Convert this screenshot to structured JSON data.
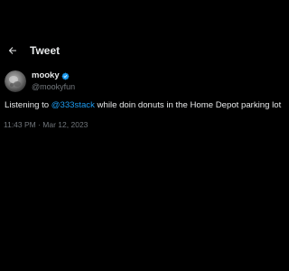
{
  "header": {
    "title": "Tweet",
    "back_icon": "back-arrow-icon"
  },
  "author": {
    "display_name": "mooky",
    "handle": "@mookyfun",
    "verified_icon": "verified-badge-icon",
    "verified_color": "#1d9bf0"
  },
  "tweet": {
    "text_before": "Listening to ",
    "mention": "@333stack",
    "text_after": " while doin donuts in the Home Depot parking lot",
    "timestamp": "11:43 PM · Mar 12, 2023"
  },
  "colors": {
    "background": "#000000",
    "text": "#e7e9ea",
    "secondary": "#71767b",
    "accent": "#1d9bf0"
  }
}
